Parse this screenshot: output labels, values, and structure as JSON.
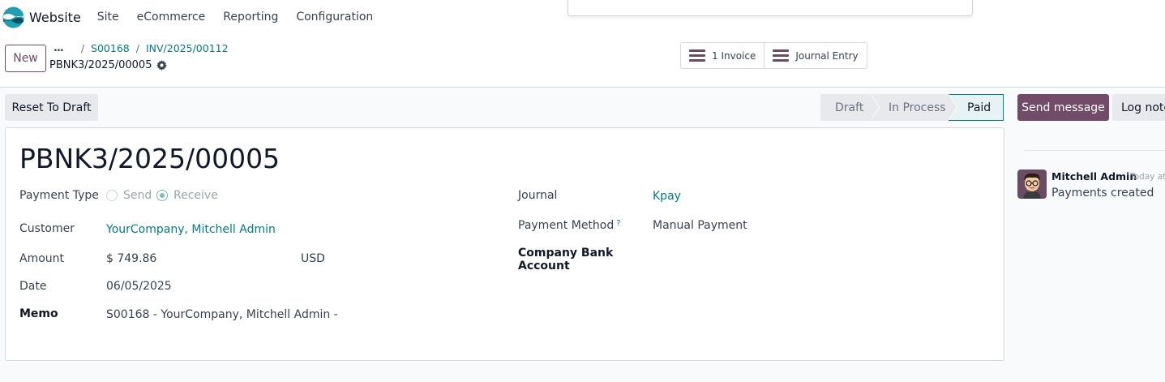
{
  "navbar": {
    "app_name": "Website",
    "menu": [
      "Site",
      "eCommerce",
      "Reporting",
      "Configuration"
    ]
  },
  "control_panel": {
    "new_label": "New",
    "breadcrumb": {
      "ellipsis": "...",
      "separator": "/",
      "items": [
        "S00168",
        "INV/2025/00112"
      ]
    },
    "record_name": "PBNK3/2025/00005",
    "smart_buttons": {
      "invoice_label": "1 Invoice",
      "journal_entry_label": "Journal Entry"
    }
  },
  "statusbar": {
    "reset_label": "Reset To Draft",
    "stages": [
      "Draft",
      "In Process",
      "Paid"
    ],
    "current_stage": "Paid"
  },
  "form": {
    "title": "PBNK3/2025/00005",
    "payment_type": {
      "label": "Payment Type",
      "options": [
        "Send",
        "Receive"
      ],
      "selected": "Receive"
    },
    "customer": {
      "label": "Customer",
      "value": "YourCompany, Mitchell Admin"
    },
    "amount": {
      "label": "Amount",
      "value": "$ 749.86",
      "currency": "USD"
    },
    "date": {
      "label": "Date",
      "value": "06/05/2025"
    },
    "memo": {
      "label": "Memo",
      "value": "S00168 - YourCompany, Mitchell Admin -"
    },
    "journal": {
      "label": "Journal",
      "value": "Kpay"
    },
    "payment_method": {
      "label": "Payment Method",
      "help": "?",
      "value": "Manual Payment"
    },
    "company_bank_account": {
      "label_line1": "Company Bank",
      "label_line2": "Account"
    }
  },
  "chatter": {
    "send_message_label": "Send message",
    "log_note_label": "Log note",
    "message": {
      "author": "Mitchell Admin",
      "date": "Today at",
      "body": "Payments created"
    }
  },
  "colors": {
    "brand": "#714b67",
    "link": "#017e84",
    "radio_accent": "#7cbcc0"
  }
}
